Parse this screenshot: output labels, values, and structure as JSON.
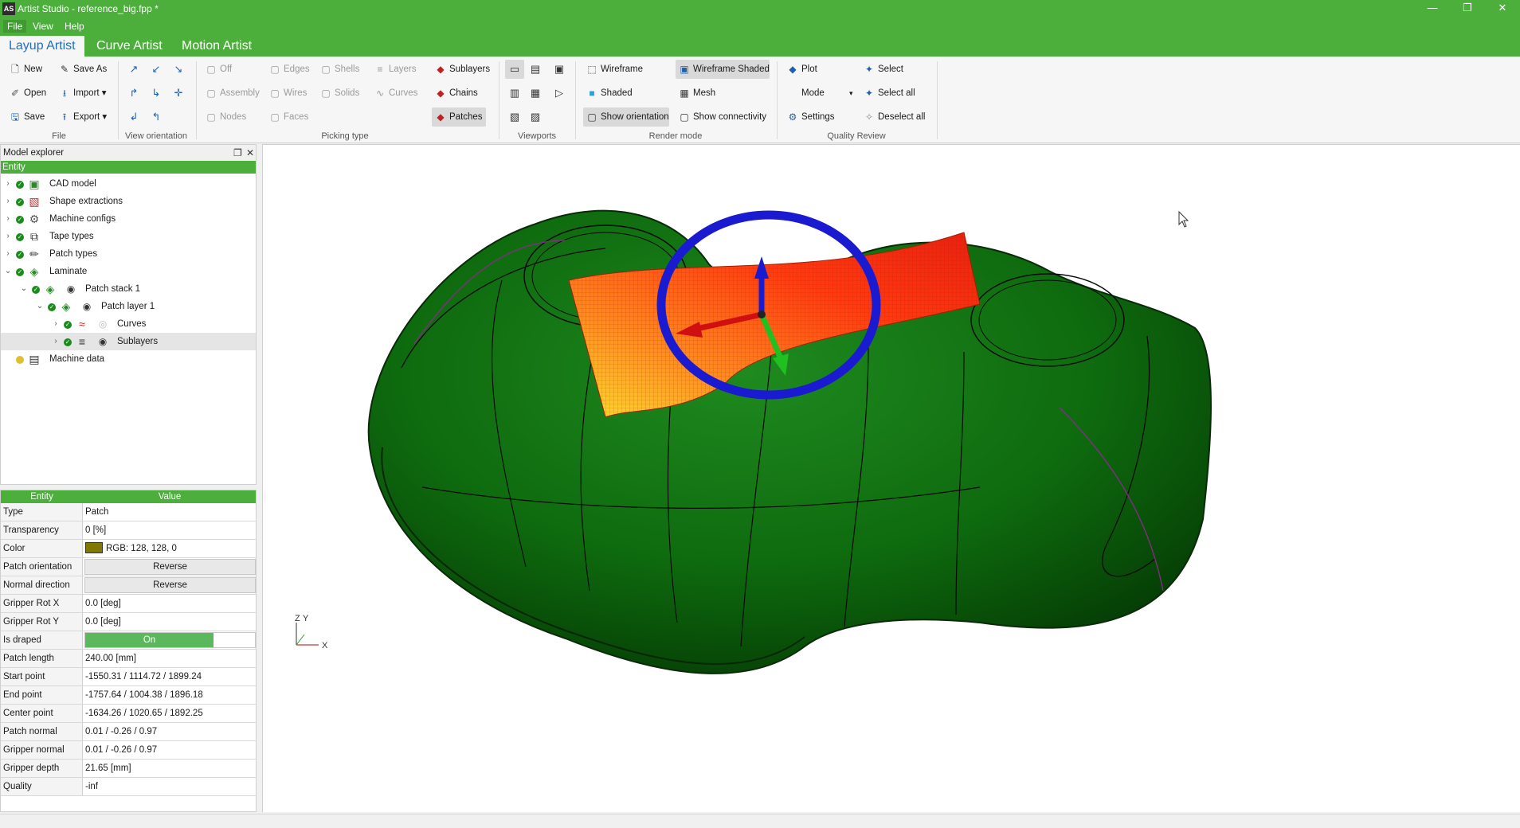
{
  "window": {
    "title": "Artist Studio - reference_big.fpp *",
    "app_icon": "AS",
    "minimize": "—",
    "restore": "❐",
    "close": "✕"
  },
  "menu": [
    "File",
    "View",
    "Help"
  ],
  "tabs": [
    "Layup Artist",
    "Curve Artist",
    "Motion Artist"
  ],
  "ribbon": {
    "file": {
      "new": "New",
      "save_as": "Save As",
      "open": "Open",
      "import": "Import ▾",
      "save": "Save",
      "export": "Export ▾",
      "label": "File"
    },
    "view_orientation": {
      "label": "View orientation"
    },
    "picking": {
      "off": "Off",
      "edges": "Edges",
      "shells": "Shells",
      "layers": "Layers",
      "sublayers": "Sublayers",
      "assembly": "Assembly",
      "wires": "Wires",
      "solids": "Solids",
      "curves": "Curves",
      "chains": "Chains",
      "nodes": "Nodes",
      "faces": "Faces",
      "patches": "Patches",
      "label": "Picking type"
    },
    "viewports": {
      "label": "Viewports"
    },
    "render": {
      "wireframe": "Wireframe",
      "wireframe_shaded": "Wireframe Shaded",
      "shaded": "Shaded",
      "mesh": "Mesh",
      "show_orientation": "Show orientation",
      "show_connectivity": "Show connectivity",
      "label": "Render mode"
    },
    "quality": {
      "plot": "Plot",
      "select": "Select",
      "mode": "Mode",
      "select_all": "Select all",
      "settings": "Settings",
      "deselect_all": "Deselect all",
      "label": "Quality Review"
    }
  },
  "explorer": {
    "title": "Model explorer",
    "column": "Entity",
    "items": [
      {
        "label": "CAD model"
      },
      {
        "label": "Shape extractions"
      },
      {
        "label": "Machine configs"
      },
      {
        "label": "Tape types"
      },
      {
        "label": "Patch types"
      },
      {
        "label": "Laminate"
      },
      {
        "label": "Patch stack 1"
      },
      {
        "label": "Patch layer 1"
      },
      {
        "label": "Curves"
      },
      {
        "label": "Sublayers"
      },
      {
        "label": "Machine data"
      }
    ]
  },
  "properties": {
    "col_entity": "Entity",
    "col_value": "Value",
    "rows": [
      {
        "key": "Type",
        "value": "Patch"
      },
      {
        "key": "Transparency",
        "value": "0 [%]"
      },
      {
        "key": "Color",
        "value": "RGB: 128, 128, 0"
      },
      {
        "key": "Patch orientation",
        "value": "Reverse"
      },
      {
        "key": "Normal direction",
        "value": "Reverse"
      },
      {
        "key": "Gripper Rot X",
        "value": "0.0 [deg]"
      },
      {
        "key": "Gripper Rot Y",
        "value": "0.0 [deg]"
      },
      {
        "key": "Is draped",
        "value": "On"
      },
      {
        "key": "Patch length",
        "value": "240.00 [mm]"
      },
      {
        "key": "Start point",
        "value": "-1550.31 / 1114.72 / 1899.24"
      },
      {
        "key": "End point",
        "value": "-1757.64 / 1004.38 / 1896.18"
      },
      {
        "key": "Center point",
        "value": "-1634.26 / 1020.65 / 1892.25"
      },
      {
        "key": "Patch normal",
        "value": "0.01 / -0.26 / 0.97"
      },
      {
        "key": "Gripper normal",
        "value": "0.01 / -0.26 / 0.97"
      },
      {
        "key": "Gripper depth",
        "value": "21.65 [mm]"
      },
      {
        "key": "Quality",
        "value": "-inf"
      }
    ]
  },
  "viewport": {
    "axis_z": "Z",
    "axis_y": "Y",
    "axis_x": "X"
  },
  "colors": {
    "accent": "#4caf3c",
    "part": "#0d6b0d",
    "patch": "#e83c10",
    "gizmo_ring": "#1a1ad0"
  }
}
